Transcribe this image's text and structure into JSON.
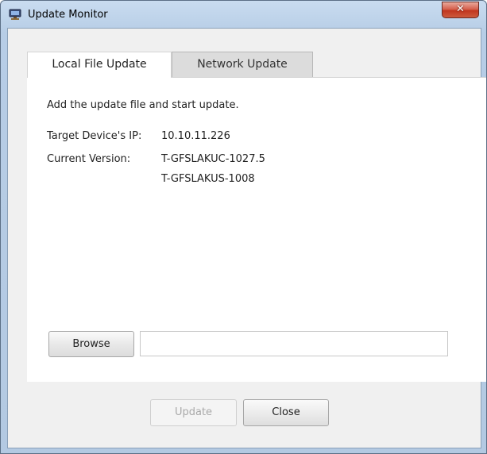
{
  "window": {
    "title": "Update Monitor",
    "close_glyph": "✕"
  },
  "tabs": [
    {
      "label": "Local File Update",
      "selected": true
    },
    {
      "label": "Network Update",
      "selected": false
    }
  ],
  "local_file_update": {
    "instruction": "Add the update file and start update.",
    "target_ip_label": "Target Device's IP:",
    "target_ip_value": "10.10.11.226",
    "current_version_label": "Current Version:",
    "current_versions": [
      "T-GFSLAKUC-1027.5",
      "T-GFSLAKUS-1008"
    ],
    "browse_label": "Browse",
    "file_path_value": ""
  },
  "footer": {
    "update_label": "Update",
    "update_enabled": false,
    "close_label": "Close"
  },
  "icons": {
    "app": "monitor-icon",
    "close": "close-icon"
  },
  "colors": {
    "titlebar": "#b7cde6",
    "close_button": "#c1361f",
    "client_background": "#f0f0f0",
    "disabled_text": "#a9a9a9"
  }
}
